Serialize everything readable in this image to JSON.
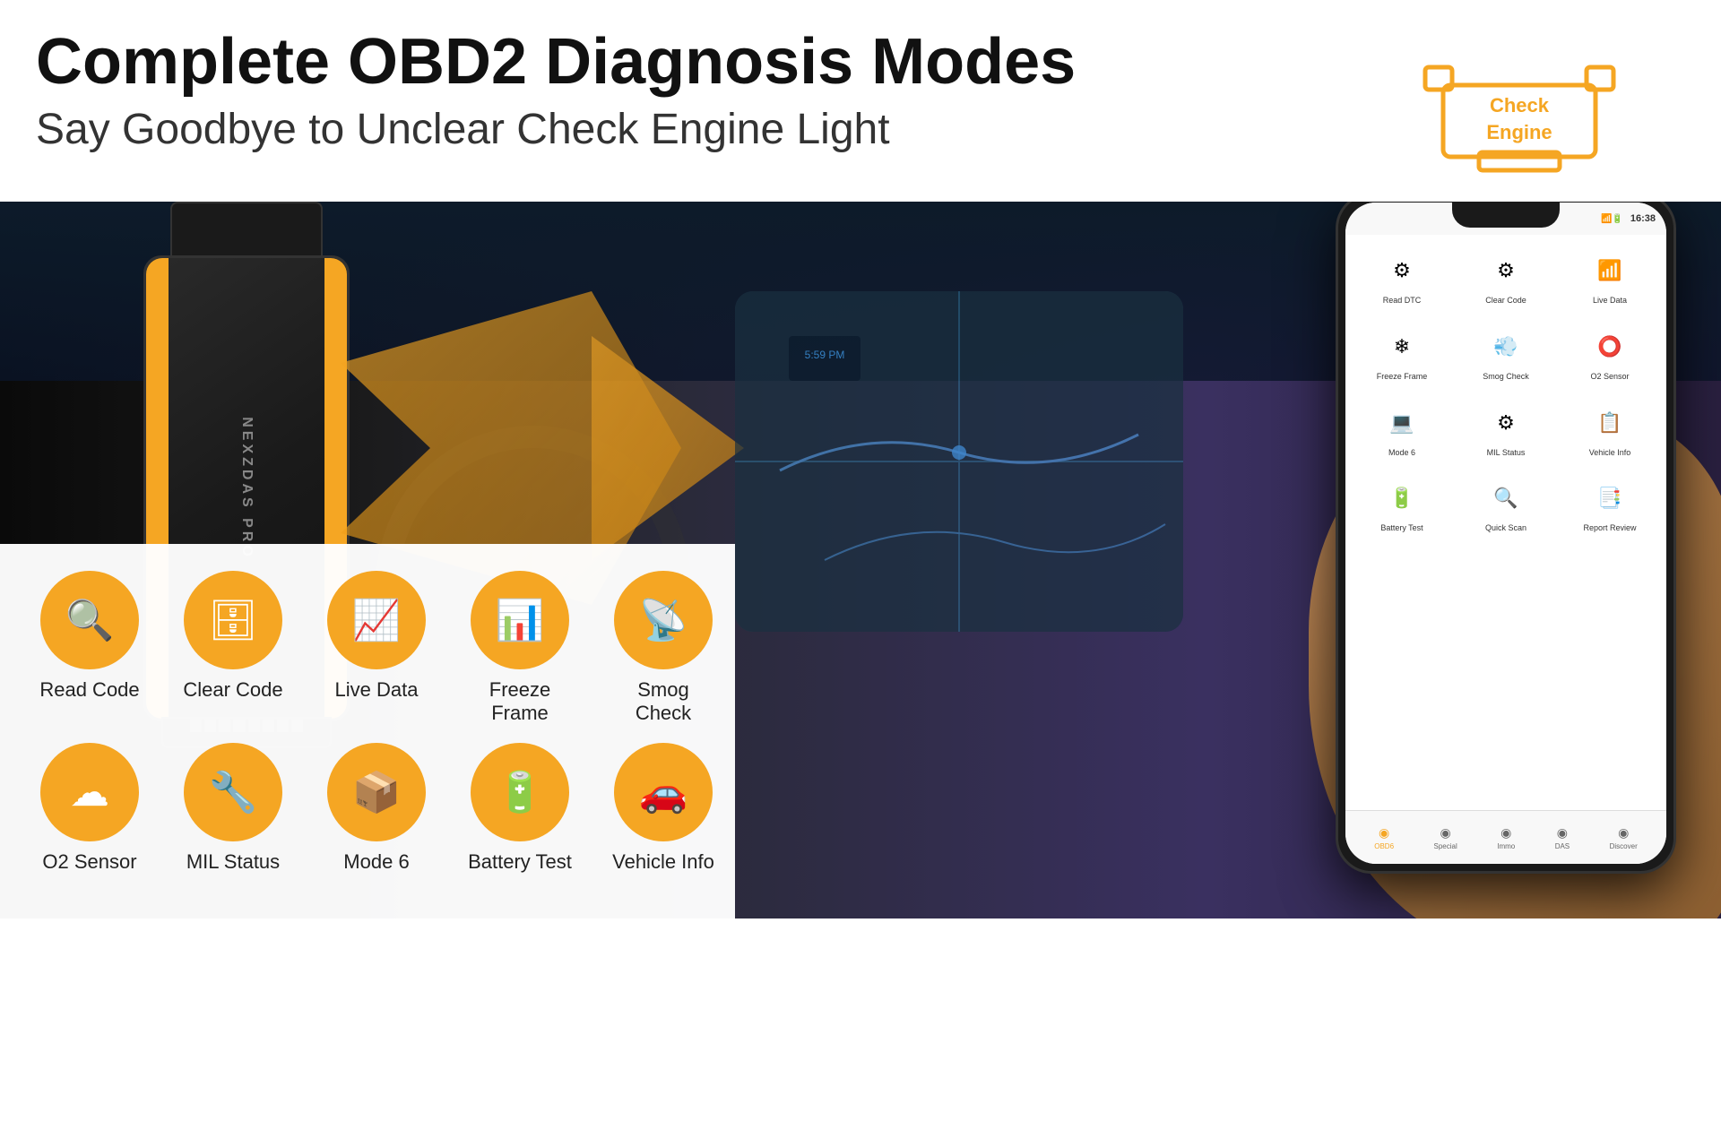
{
  "header": {
    "title": "Complete OBD2 Diagnosis Modes",
    "subtitle": "Say Goodbye to Unclear Check Engine Light",
    "badge_line1": "Check",
    "badge_line2": "Engine"
  },
  "obd_device": {
    "brand": "NEXZDAS PRO"
  },
  "bottom_icons_row1": [
    {
      "id": "read-code",
      "label": "Read Code",
      "symbol": "🔍"
    },
    {
      "id": "clear-code",
      "label": "Clear Code",
      "symbol": "🗄"
    },
    {
      "id": "live-data",
      "label": "Live Data",
      "symbol": "📈"
    },
    {
      "id": "freeze-frame",
      "label": "Freeze Frame",
      "symbol": "📊"
    },
    {
      "id": "smog-check",
      "label": "Smog Check",
      "symbol": "📡"
    }
  ],
  "bottom_icons_row2": [
    {
      "id": "o2-sensor",
      "label": "O2 Sensor",
      "symbol": "☁"
    },
    {
      "id": "mil-status",
      "label": "MIL Status",
      "symbol": "🔧"
    },
    {
      "id": "mode-6",
      "label": "Mode 6",
      "symbol": "📦"
    },
    {
      "id": "battery-test",
      "label": "Battery Test",
      "symbol": "🔋"
    },
    {
      "id": "vehicle-info",
      "label": "Vehicle Info",
      "symbol": "🚗"
    }
  ],
  "phone_app_grid": [
    {
      "label": "Read DTC",
      "symbol": "⚙"
    },
    {
      "label": "Clear Code",
      "symbol": "⚙"
    },
    {
      "label": "Live Data",
      "symbol": "📶"
    },
    {
      "label": "Freeze Frame",
      "symbol": "❄"
    },
    {
      "label": "Smog Check",
      "symbol": "💨"
    },
    {
      "label": "O2 Sensor",
      "symbol": "⭕"
    },
    {
      "label": "Mode 6",
      "symbol": "💻"
    },
    {
      "label": "MIL Status",
      "symbol": "⚙"
    },
    {
      "label": "Vehicle Info",
      "symbol": "📋"
    },
    {
      "label": "Battery Test",
      "symbol": "🔋"
    },
    {
      "label": "Quick Scan",
      "symbol": "🔍"
    },
    {
      "label": "Report Review",
      "symbol": "📑"
    }
  ],
  "phone_nav": [
    {
      "label": "OBD6",
      "active": true
    },
    {
      "label": "Special",
      "active": false
    },
    {
      "label": "Immo",
      "active": false
    },
    {
      "label": "DAS",
      "active": false
    },
    {
      "label": "Discover",
      "active": false
    }
  ],
  "phone_status": "16:38",
  "colors": {
    "orange": "#f5a623",
    "dark": "#1a1a1a",
    "white": "#ffffff"
  }
}
